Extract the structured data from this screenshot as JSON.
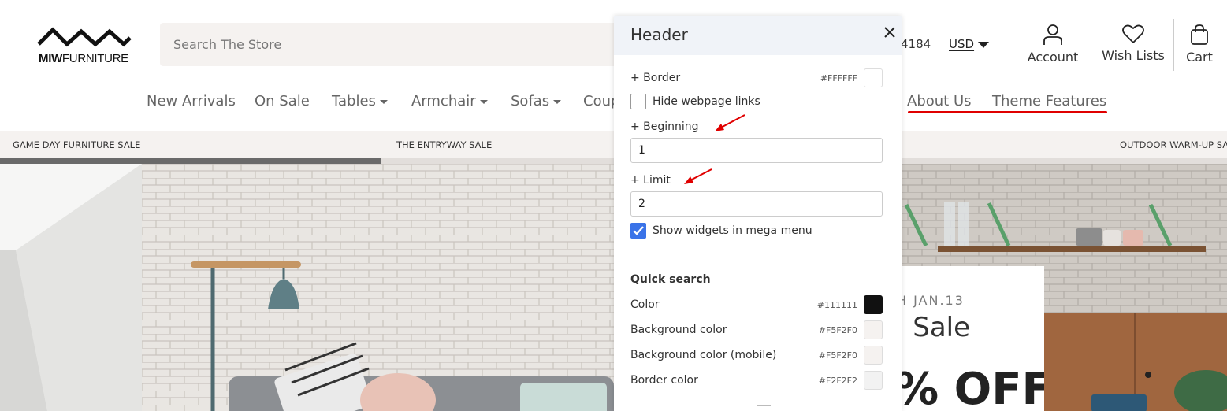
{
  "header": {
    "logo": {
      "brand_bold": "MIW",
      "brand_light": "FURNITURE"
    },
    "search": {
      "placeholder": "Search The Store"
    },
    "phone_tail": "4184",
    "currency": "USD",
    "account_label": "Account",
    "wishlist_label": "Wish Lists",
    "cart_label": "Cart"
  },
  "nav": {
    "items": [
      {
        "label": "New Arrivals"
      },
      {
        "label": "On Sale"
      },
      {
        "label": "Tables"
      },
      {
        "label": "Armchair"
      },
      {
        "label": "Sofas"
      },
      {
        "label": "Coup"
      },
      {
        "label": "About Us"
      },
      {
        "label": "Theme Features"
      }
    ],
    "highlight_color": "#E00000"
  },
  "promo_bar": {
    "items": [
      {
        "label": "GAME DAY FURNITURE SALE"
      },
      {
        "label": "THE ENTRYWAY SALE"
      },
      {
        "label": "OUTDOOR WARM-UP SA"
      }
    ]
  },
  "hero": {
    "date_text": "H JAN.13",
    "sale_text": "l Sale",
    "off_text": "% OFF"
  },
  "panel": {
    "title": "Header",
    "border": {
      "label": "+ Border",
      "hex": "#FFFFFF",
      "color": "#FFFFFF"
    },
    "hide_links": {
      "label": "Hide webpage links",
      "checked": false
    },
    "beginning": {
      "label": "+ Beginning",
      "value": "1"
    },
    "limit": {
      "label": "+ Limit",
      "value": "2"
    },
    "show_widgets": {
      "label": "Show widgets in mega menu",
      "checked": true
    },
    "quick_search": {
      "heading": "Quick search",
      "rows": [
        {
          "label": "Color",
          "hex": "#111111",
          "color": "#111111"
        },
        {
          "label": "Background color",
          "hex": "#F5F2F0",
          "color": "#F5F2F0"
        },
        {
          "label": "Background color (mobile)",
          "hex": "#F5F2F0",
          "color": "#F5F2F0"
        },
        {
          "label": "Border color",
          "hex": "#F2F2F2",
          "color": "#F2F2F2"
        }
      ]
    }
  },
  "colors": {
    "accent_blue": "#3A73E8",
    "annotation_red": "#E00000",
    "search_bg": "#F5F2F0"
  }
}
